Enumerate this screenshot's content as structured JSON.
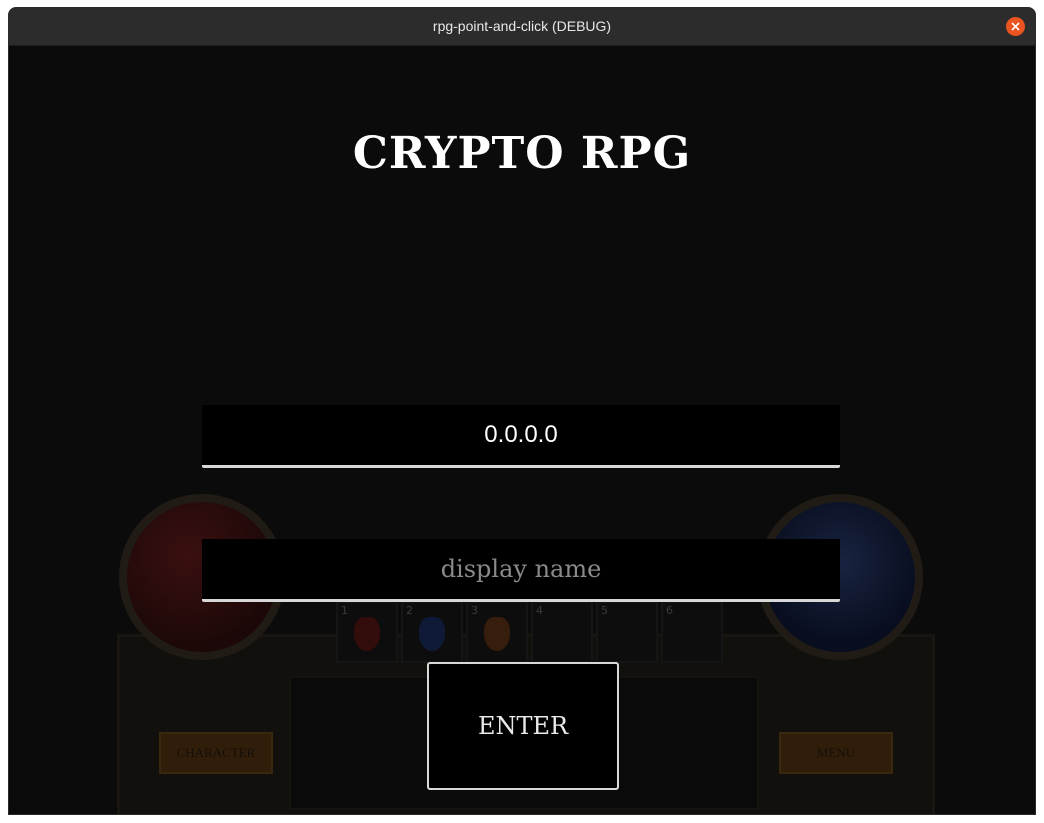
{
  "window": {
    "title": "rpg-point-and-click (DEBUG)"
  },
  "game": {
    "title": "CRYPTO RPG",
    "ip_field": {
      "value": "0.0.0.0",
      "placeholder": ""
    },
    "name_field": {
      "value": "",
      "placeholder": "display name"
    },
    "enter_label": "ENTER"
  },
  "hud": {
    "character_label": "CHARACTER",
    "menu_label": "MENU",
    "slots": [
      "1",
      "2",
      "3",
      "4",
      "5",
      "6"
    ],
    "colors": {
      "health": "#c01010",
      "mana": "#2050d0",
      "button": "#b8620a"
    }
  },
  "colors": {
    "close_button": "#e95420",
    "background": "#0b0b0b"
  }
}
